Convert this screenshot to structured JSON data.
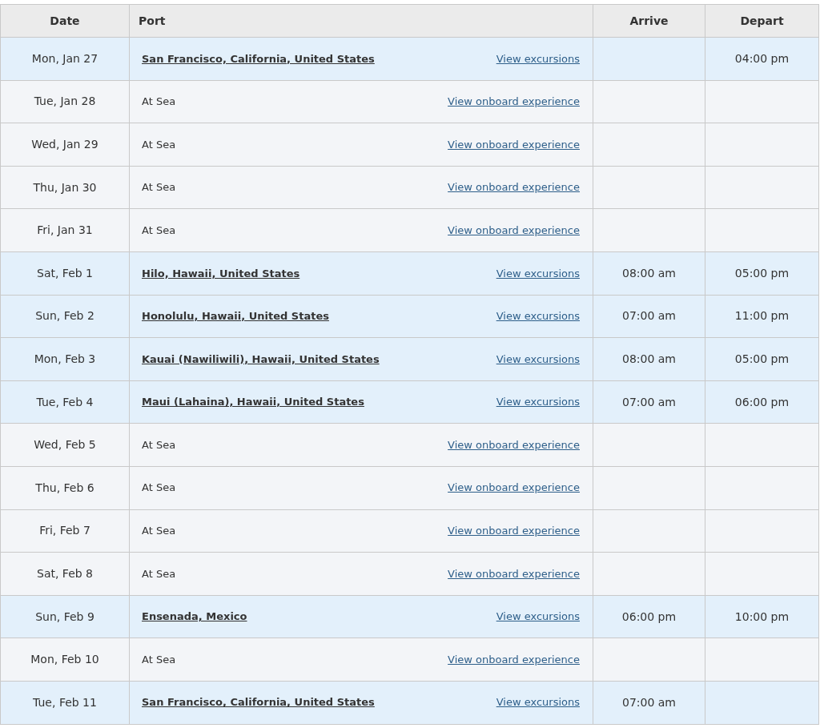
{
  "table": {
    "columns": [
      "Date",
      "Port",
      "Arrive",
      "Depart"
    ],
    "rows": [
      {
        "kind": "port",
        "date": "Mon, Jan 27",
        "port": "San Francisco, California, United States",
        "link": "View excursions",
        "arrive": "",
        "depart": "04:00 pm"
      },
      {
        "kind": "sea",
        "date": "Tue, Jan 28",
        "port": "At Sea",
        "link": "View onboard experience",
        "arrive": "",
        "depart": ""
      },
      {
        "kind": "sea",
        "date": "Wed, Jan 29",
        "port": "At Sea",
        "link": "View onboard experience",
        "arrive": "",
        "depart": ""
      },
      {
        "kind": "sea",
        "date": "Thu, Jan 30",
        "port": "At Sea",
        "link": "View onboard experience",
        "arrive": "",
        "depart": ""
      },
      {
        "kind": "sea",
        "date": "Fri, Jan 31",
        "port": "At Sea",
        "link": "View onboard experience",
        "arrive": "",
        "depart": ""
      },
      {
        "kind": "port",
        "date": "Sat, Feb 1",
        "port": "Hilo, Hawaii, United States",
        "link": "View excursions",
        "arrive": "08:00 am",
        "depart": "05:00 pm"
      },
      {
        "kind": "port",
        "date": "Sun, Feb 2",
        "port": "Honolulu, Hawaii, United States",
        "link": "View excursions",
        "arrive": "07:00 am",
        "depart": "11:00 pm"
      },
      {
        "kind": "port",
        "date": "Mon, Feb 3",
        "port": "Kauai (Nawiliwili), Hawaii, United States",
        "link": "View excursions",
        "arrive": "08:00 am",
        "depart": "05:00 pm"
      },
      {
        "kind": "port",
        "date": "Tue, Feb 4",
        "port": "Maui (Lahaina), Hawaii, United States",
        "link": "View excursions",
        "arrive": "07:00 am",
        "depart": "06:00 pm"
      },
      {
        "kind": "sea",
        "date": "Wed, Feb 5",
        "port": "At Sea",
        "link": "View onboard experience",
        "arrive": "",
        "depart": ""
      },
      {
        "kind": "sea",
        "date": "Thu, Feb 6",
        "port": "At Sea",
        "link": "View onboard experience",
        "arrive": "",
        "depart": ""
      },
      {
        "kind": "sea",
        "date": "Fri, Feb 7",
        "port": "At Sea",
        "link": "View onboard experience",
        "arrive": "",
        "depart": ""
      },
      {
        "kind": "sea",
        "date": "Sat, Feb 8",
        "port": "At Sea",
        "link": "View onboard experience",
        "arrive": "",
        "depart": ""
      },
      {
        "kind": "port",
        "date": "Sun, Feb 9",
        "port": "Ensenada, Mexico",
        "link": "View excursions",
        "arrive": "06:00 pm",
        "depart": "10:00 pm"
      },
      {
        "kind": "sea",
        "date": "Mon, Feb 10",
        "port": "At Sea",
        "link": "View onboard experience",
        "arrive": "",
        "depart": ""
      },
      {
        "kind": "port",
        "date": "Tue, Feb 11",
        "port": "San Francisco, California, United States",
        "link": "View excursions",
        "arrive": "07:00 am",
        "depart": ""
      }
    ]
  }
}
